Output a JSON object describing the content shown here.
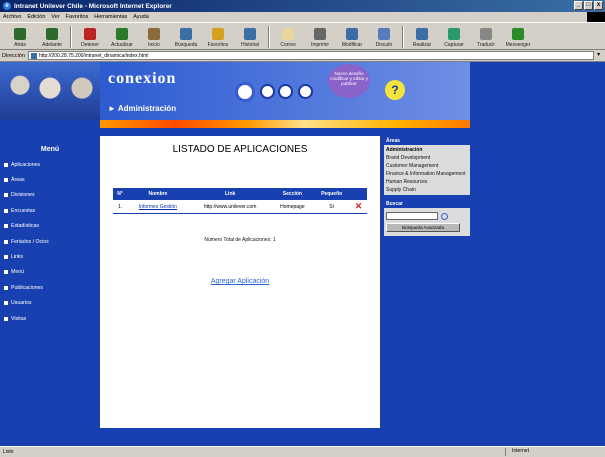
{
  "window": {
    "title": "Intranet Unilever Chile - Microsoft Internet Explorer",
    "min": "_",
    "max": "□",
    "close": "x"
  },
  "menubar": [
    "Archivo",
    "Edición",
    "Ver",
    "Favoritos",
    "Herramientas",
    "Ayuda"
  ],
  "toolbar": [
    {
      "label": "Atrás",
      "icon": "back-arrow-icon",
      "color": "#2e6a2e"
    },
    {
      "label": "Adelante",
      "icon": "forward-arrow-icon",
      "color": "#2e6a2e"
    },
    {
      "label": "Detener",
      "icon": "stop-icon",
      "color": "#b22"
    },
    {
      "label": "Actualizar",
      "icon": "refresh-icon",
      "color": "#2a7a2a"
    },
    {
      "label": "Inicio",
      "icon": "home-icon",
      "color": "#8a6a3a"
    },
    {
      "label": "Búsqueda",
      "icon": "search-icon",
      "color": "#3a6ea5"
    },
    {
      "label": "Favoritos",
      "icon": "favorites-icon",
      "color": "#d4a020"
    },
    {
      "label": "Historial",
      "icon": "history-icon",
      "color": "#3a6ea5"
    },
    {
      "label": "Correo",
      "icon": "mail-icon",
      "color": "#e8d6a0"
    },
    {
      "label": "Imprimir",
      "icon": "print-icon",
      "color": "#666"
    },
    {
      "label": "Modificar",
      "icon": "edit-icon",
      "color": "#3a6ea5"
    },
    {
      "label": "Discutir",
      "icon": "discuss-icon",
      "color": "#5a7ac0"
    },
    {
      "label": "Realizar",
      "icon": "realizar-icon",
      "color": "#3a6ea5"
    },
    {
      "label": "Capturar",
      "icon": "capture-icon",
      "color": "#2a9a6a"
    },
    {
      "label": "Traducir",
      "icon": "translate-icon",
      "color": "#888"
    },
    {
      "label": "Messenger",
      "icon": "messenger-icon",
      "color": "#2a8a2a"
    }
  ],
  "address": {
    "label": "Dirección",
    "url": "http://200.28.75.200/intranet_dinamica/index.html"
  },
  "header": {
    "logo": "conexion",
    "section": "► Administración",
    "promo": "Nuevo desafío modificar y editar y publicar",
    "help": "?"
  },
  "leftnav": {
    "title": "Menú",
    "items": [
      "Aplicaciones",
      "Áreas",
      "Divisiones",
      "Encuestas",
      "Estadísticas",
      "Feriados / Ocios",
      "Links",
      "Menú",
      "Publicaciones",
      "Usuarios",
      "Visitas"
    ]
  },
  "content": {
    "title": "LISTADO DE APLICACIONES",
    "table": {
      "headers": [
        "N°",
        "Nombre",
        "Link",
        "Sección",
        "Pequeño",
        ""
      ],
      "rows": [
        {
          "n": "1.",
          "nombre": "Informes Gestión",
          "link": "http://www.unilever.com",
          "seccion": "Homepage",
          "peq": "Sí",
          "del": "✕"
        }
      ]
    },
    "total_text": "Número Total de Aplicaciones: 1",
    "add_link": "Agregar Aplicación"
  },
  "right": {
    "areas_title": "Áreas",
    "areas": [
      "Administración",
      "Brand Development",
      "Customer Management",
      "Finance & Information Management",
      "Human Resources",
      "Supply Chain"
    ],
    "search_title": "Buscar",
    "search_placeholder": "",
    "advanced_button": "Búsqueda Avanzada"
  },
  "status": {
    "left": "Listo",
    "zone": "Internet"
  }
}
